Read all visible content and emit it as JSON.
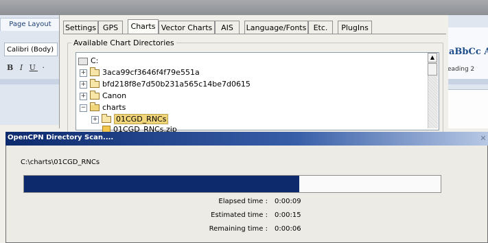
{
  "word": {
    "ribbon_tab": "Page Layout",
    "font_name": "Calibri (Body)",
    "format_buttons": {
      "bold": "B",
      "italic": "I",
      "underline": "U",
      "more": "·"
    },
    "style_sample": "aBbCc A",
    "style_name": "eading 2"
  },
  "options": {
    "tabs": [
      "Settings",
      "GPS",
      "Charts",
      "Vector Charts",
      "AIS",
      "Language/Fonts",
      "Etc.",
      "PlugIns"
    ],
    "active_tab": "Charts",
    "group_title": "Available Chart Directories",
    "tree": [
      {
        "label": "C:",
        "expander": "",
        "icon": "drive-icon"
      },
      {
        "label": "3aca99cf3646f4f79e551a",
        "expander": "+",
        "icon": "folder-icon"
      },
      {
        "label": "bfd218f8e7d50b231a565c14be7d0615",
        "expander": "+",
        "icon": "folder-icon"
      },
      {
        "label": "Canon",
        "expander": "+",
        "icon": "folder-icon"
      },
      {
        "label": "charts",
        "expander": "−",
        "icon": "folder-open-icon"
      },
      {
        "label": "01CGD_RNCs",
        "expander": "+",
        "icon": "folder-icon",
        "selected": true
      },
      {
        "label": "01CGD_RNCs.zip",
        "expander": "",
        "icon": "zip-icon"
      }
    ],
    "scroll_up_glyph": "▲"
  },
  "scan": {
    "title": "OpenCPN Directory Scan....",
    "close_glyph": "✕",
    "path": "C:\\charts\\01CGD_RNCs",
    "progress_fraction": 0.66,
    "progress_color": "#0d2a6d",
    "elapsed_label": "Elapsed time :",
    "elapsed_value": "0:00:09",
    "estimated_label": "Estimated time :",
    "estimated_value": "0:00:15",
    "remaining_label": "Remaining time :",
    "remaining_value": "0:00:06"
  }
}
